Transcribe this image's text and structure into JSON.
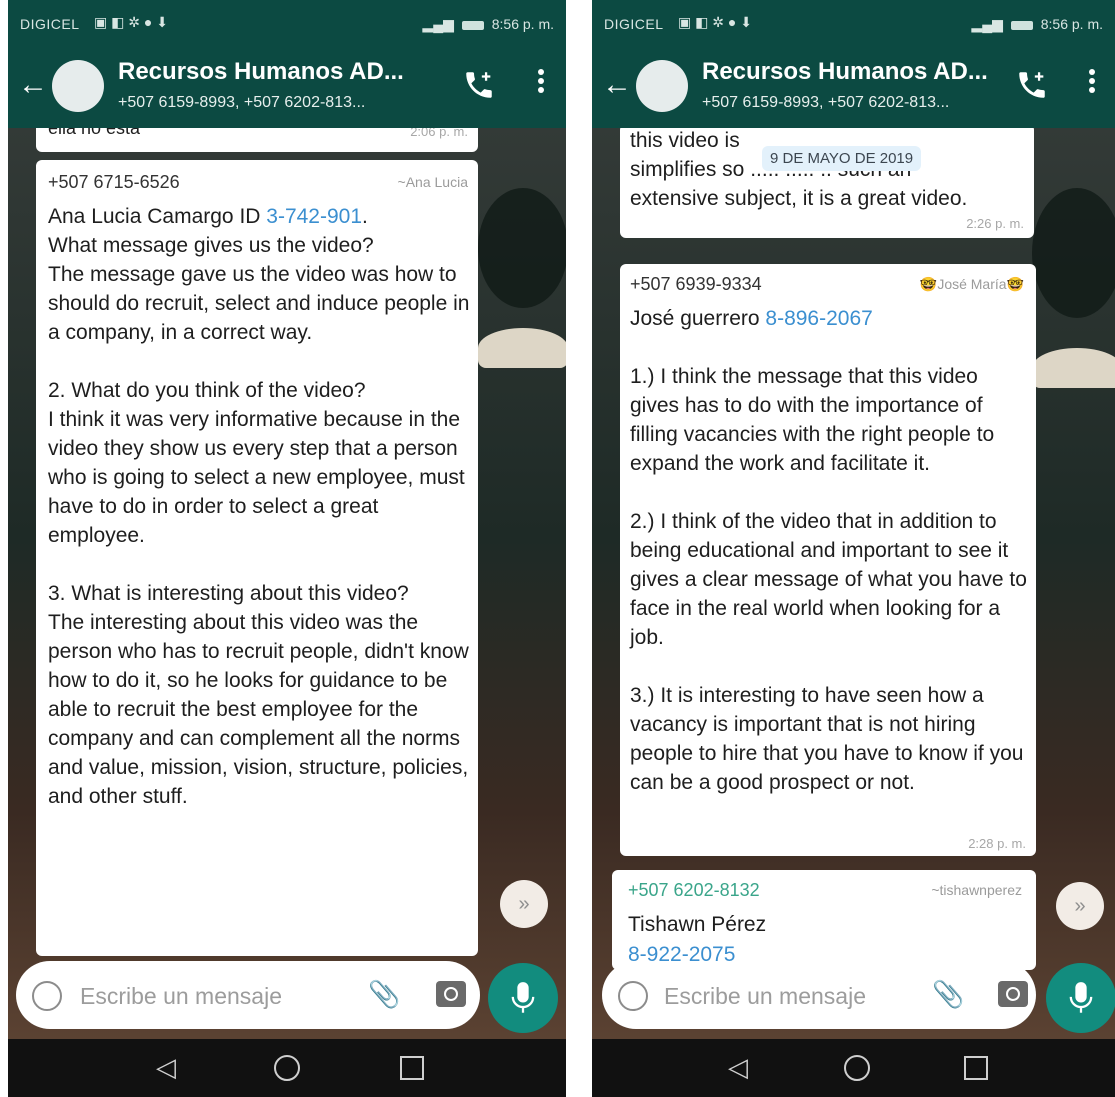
{
  "left": {
    "status": {
      "carrier": "DIGICEL",
      "time": "8:56 p. m."
    },
    "header": {
      "title": "Recursos Humanos AD...",
      "subtitle": "+507 6159-8993, +507 6202-813..."
    },
    "partial_prev": {
      "text": "ella no esta",
      "time": "2:06 p. m."
    },
    "message": {
      "sender": "+507 6715-6526",
      "alias": "~Ana Lucia",
      "name_line": "Ana Lucia Camargo ID ",
      "id_link": "3-742-901",
      "body": "What message gives us the video?\nThe message gave us the video was how to should do recruit, select and induce people in a company, in a correct way.\n\n2. What do you think of the video?\nI think it was very informative because in the video they show us every step that a person who is going to select a new employee, must have to do in order to select a great employee.\n\n3. What is interesting about this video?\nThe interesting about this video was the person who has to recruit people, didn't know how to do it, so he looks for guidance to be able to recruit the best employee for the company and can complement all the norms and value, mission, vision, structure, policies, and other stuff."
    },
    "input": {
      "placeholder": "Escribe un mensaje"
    }
  },
  "right": {
    "status": {
      "carrier": "DIGICEL",
      "time": "8:56 p. m."
    },
    "header": {
      "title": "Recursos Humanos AD...",
      "subtitle": "+507 6159-8993, +507 6202-813..."
    },
    "date_chip": "9 DE MAYO DE 2019",
    "partial_prev": {
      "text": "this video is\nsimplifies so ..... ..... .. such an\nextensive subject, it is a great video.",
      "time": "2:26 p. m."
    },
    "message": {
      "sender": "+507 6939-9334",
      "alias": "José María",
      "name_line": "José guerrero ",
      "id_link": "8-896-2067",
      "body": "1.) I think the message that this video gives has to do with the importance of filling vacancies with the right people to expand the work and facilitate it.\n\n2.) I think of the video that in addition to being educational and important to see it gives a clear message of what you have to face in the real world when looking for a job.\n\n3.) It is interesting to have seen how a vacancy is important that is not hiring people to hire that you have to know if you can be a good prospect or not.",
      "time": "2:28 p. m."
    },
    "next_message": {
      "sender": "+507 6202-8132",
      "alias": "~tishawnperez",
      "name": "Tishawn Pérez",
      "id_partial": "8-922-2075"
    },
    "input": {
      "placeholder": "Escribe un mensaje"
    }
  },
  "colors": {
    "header": "#0c4a42",
    "link": "#3b8fd0",
    "mic": "#128c7e",
    "date_chip": "#e3f1fb"
  }
}
